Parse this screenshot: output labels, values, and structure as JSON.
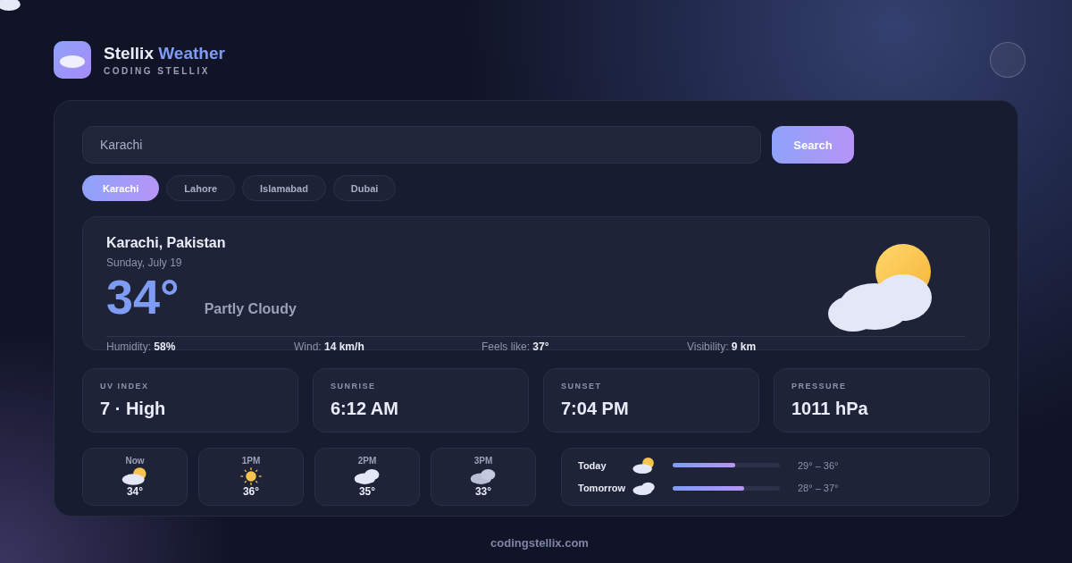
{
  "brand": {
    "name": "Stellix",
    "accent": "Weather",
    "subtitle": "CODING STELLIX"
  },
  "search": {
    "value": "Karachi",
    "button": "Search"
  },
  "cities": [
    {
      "label": "Karachi",
      "selected": true
    },
    {
      "label": "Lahore",
      "selected": false
    },
    {
      "label": "Islamabad",
      "selected": false
    },
    {
      "label": "Dubai",
      "selected": false
    }
  ],
  "current": {
    "location": "Karachi, Pakistan",
    "date": "Sunday, July 19",
    "temperature": "34°",
    "condition": "Partly Cloudy",
    "kind": "partly",
    "stats": [
      {
        "label": "Humidity:",
        "value": "58%"
      },
      {
        "label": "Wind:",
        "value": "14 km/h"
      },
      {
        "label": "Feels like:",
        "value": "37°"
      },
      {
        "label": "Visibility:",
        "value": "9 km"
      }
    ]
  },
  "metrics": [
    {
      "label": "UV INDEX",
      "value": "7 · High"
    },
    {
      "label": "SUNRISE",
      "value": "6:12 AM"
    },
    {
      "label": "SUNSET",
      "value": "7:04 PM"
    },
    {
      "label": "PRESSURE",
      "value": "1011 hPa"
    }
  ],
  "hourly": [
    {
      "time": "Now",
      "kind": "partly",
      "temp": "34°"
    },
    {
      "time": "1PM",
      "kind": "sunny",
      "temp": "36°"
    },
    {
      "time": "2PM",
      "kind": "cloudy",
      "temp": "35°"
    },
    {
      "time": "3PM",
      "kind": "overcast",
      "temp": "33°"
    }
  ],
  "daily": [
    {
      "day": "Today",
      "kind": "partly",
      "level": 0.58,
      "range": "29° – 36°"
    },
    {
      "day": "Tomorrow",
      "kind": "cloudy",
      "level": 0.67,
      "range": "28° – 37°"
    }
  ],
  "footer": "codingstellix.com"
}
